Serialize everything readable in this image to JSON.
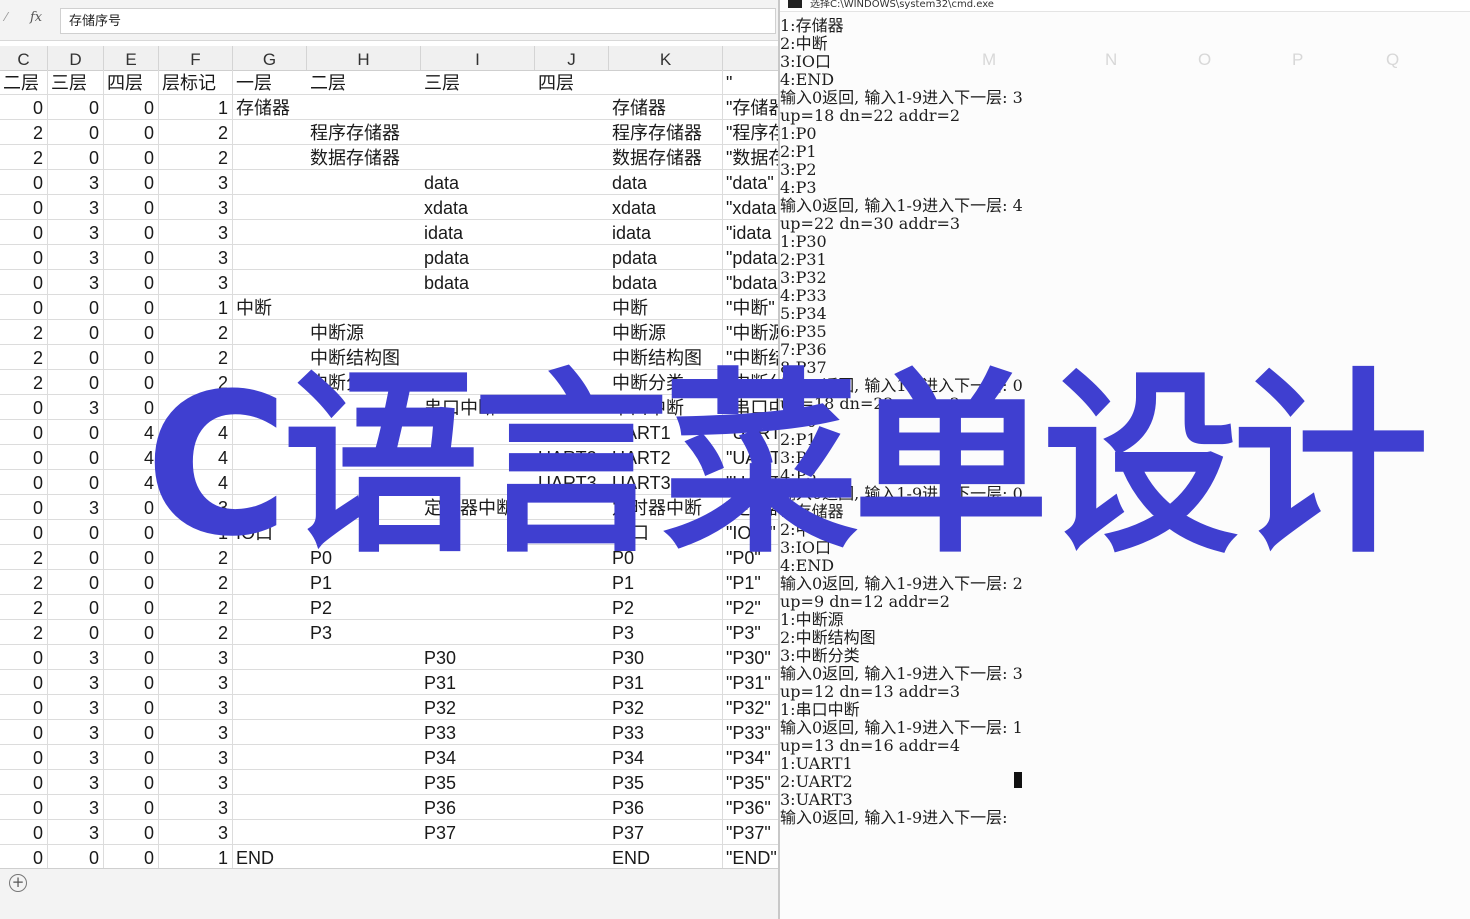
{
  "formula_bar": {
    "fx_label": "fx",
    "cell_value": "存储序号"
  },
  "columns": [
    "C",
    "D",
    "E",
    "F",
    "G",
    "H",
    "I",
    "J",
    "K"
  ],
  "header_row": [
    "二层",
    "三层",
    "四层",
    "层标记",
    "一层",
    "二层",
    "三层",
    "四层",
    "",
    "\""
  ],
  "rows": [
    [
      "0",
      "0",
      "0",
      "1",
      "存储器",
      "",
      "",
      "",
      "存储器",
      "\"存储器"
    ],
    [
      "2",
      "0",
      "0",
      "2",
      "",
      "程序存储器",
      "",
      "",
      "程序存储器",
      "\"程序存"
    ],
    [
      "2",
      "0",
      "0",
      "2",
      "",
      "数据存储器",
      "",
      "",
      "数据存储器",
      "\"数据存"
    ],
    [
      "0",
      "3",
      "0",
      "3",
      "",
      "",
      "data",
      "",
      "data",
      "\"data\""
    ],
    [
      "0",
      "3",
      "0",
      "3",
      "",
      "",
      "xdata",
      "",
      "xdata",
      "\"xdata"
    ],
    [
      "0",
      "3",
      "0",
      "3",
      "",
      "",
      "idata",
      "",
      "idata",
      "\"idata"
    ],
    [
      "0",
      "3",
      "0",
      "3",
      "",
      "",
      "pdata",
      "",
      "pdata",
      "\"pdata"
    ],
    [
      "0",
      "3",
      "0",
      "3",
      "",
      "",
      "bdata",
      "",
      "bdata",
      "\"bdata"
    ],
    [
      "0",
      "0",
      "0",
      "1",
      "中断",
      "",
      "",
      "",
      "中断",
      "\"中断\""
    ],
    [
      "2",
      "0",
      "0",
      "2",
      "",
      "中断源",
      "",
      "",
      "中断源",
      "\"中断源"
    ],
    [
      "2",
      "0",
      "0",
      "2",
      "",
      "中断结构图",
      "",
      "",
      "中断结构图",
      "\"中断结"
    ],
    [
      "2",
      "0",
      "0",
      "2",
      "",
      "中断分类",
      "",
      "",
      "中断分类",
      "\"中断分"
    ],
    [
      "0",
      "3",
      "0",
      "3",
      "",
      "",
      "串口中断",
      "",
      "串口中断",
      "\"串口中"
    ],
    [
      "0",
      "0",
      "4",
      "4",
      "",
      "",
      "",
      "UART1",
      "UART1",
      "\"UART1"
    ],
    [
      "0",
      "0",
      "4",
      "4",
      "",
      "",
      "",
      "UART2",
      "UART2",
      "\"UART2"
    ],
    [
      "0",
      "0",
      "4",
      "4",
      "",
      "",
      "",
      "UART3",
      "UART3",
      "\"UART3"
    ],
    [
      "0",
      "3",
      "0",
      "3",
      "",
      "",
      "定时器中断",
      "",
      "定时器中断",
      "\"定时器"
    ],
    [
      "0",
      "0",
      "0",
      "1",
      "IO口",
      "",
      "",
      "",
      "IO口",
      "\"IO口\""
    ],
    [
      "2",
      "0",
      "0",
      "2",
      "",
      "P0",
      "",
      "",
      "P0",
      "\"P0\""
    ],
    [
      "2",
      "0",
      "0",
      "2",
      "",
      "P1",
      "",
      "",
      "P1",
      "\"P1\""
    ],
    [
      "2",
      "0",
      "0",
      "2",
      "",
      "P2",
      "",
      "",
      "P2",
      "\"P2\""
    ],
    [
      "2",
      "0",
      "0",
      "2",
      "",
      "P3",
      "",
      "",
      "P3",
      "\"P3\""
    ],
    [
      "0",
      "3",
      "0",
      "3",
      "",
      "",
      "P30",
      "",
      "P30",
      "\"P30\""
    ],
    [
      "0",
      "3",
      "0",
      "3",
      "",
      "",
      "P31",
      "",
      "P31",
      "\"P31\""
    ],
    [
      "0",
      "3",
      "0",
      "3",
      "",
      "",
      "P32",
      "",
      "P32",
      "\"P32\""
    ],
    [
      "0",
      "3",
      "0",
      "3",
      "",
      "",
      "P33",
      "",
      "P33",
      "\"P33\""
    ],
    [
      "0",
      "3",
      "0",
      "3",
      "",
      "",
      "P34",
      "",
      "P34",
      "\"P34\""
    ],
    [
      "0",
      "3",
      "0",
      "3",
      "",
      "",
      "P35",
      "",
      "P35",
      "\"P35\""
    ],
    [
      "0",
      "3",
      "0",
      "3",
      "",
      "",
      "P36",
      "",
      "P36",
      "\"P36\""
    ],
    [
      "0",
      "3",
      "0",
      "3",
      "",
      "",
      "P37",
      "",
      "P37",
      "\"P37\""
    ],
    [
      "0",
      "0",
      "0",
      "1",
      "END",
      "",
      "",
      "",
      "END",
      "\"END\""
    ]
  ],
  "sheet_add_label": "+",
  "cmd": {
    "title": "选择C:\\WINDOWS\\system32\\cmd.exe",
    "faint_columns": [
      "M",
      "N",
      "O",
      "P",
      "Q"
    ],
    "lines": [
      "1:存储器",
      "2:中断",
      "3:IO口",
      "4:END",
      "输入0返回, 输入1-9进入下一层: 3",
      "up=18 dn=22 addr=2",
      "1:P0",
      "2:P1",
      "3:P2",
      "4:P3",
      "输入0返回, 输入1-9进入下一层: 4",
      "up=22 dn=30 addr=3",
      "1:P30",
      "2:P31",
      "3:P32",
      "4:P33",
      "5:P34",
      "6:P35",
      "7:P36",
      "8:P37",
      "输入0返回, 输入1-9进入下一层: 0",
      "up=18 dn=22 addr=2",
      "1:P0",
      "2:P1",
      "3:P2",
      "4:P3",
      "输入0返回, 输入1-9进入下一层: 0",
      "1:存储器",
      "2:中断",
      "3:IO口",
      "4:END",
      "输入0返回, 输入1-9进入下一层: 2",
      "up=9 dn=12 addr=2",
      "1:中断源",
      "2:中断结构图",
      "3:中断分类",
      "输入0返回, 输入1-9进入下一层: 3",
      "up=12 dn=13 addr=3",
      "1:串口中断",
      "输入0返回, 输入1-9进入下一层: 1",
      "up=13 dn=16 addr=4",
      "1:UART1",
      "2:UART2",
      "3:UART3",
      "输入0返回, 输入1-9进入下一层:"
    ]
  },
  "overlay_title": "C语言菜单设计"
}
